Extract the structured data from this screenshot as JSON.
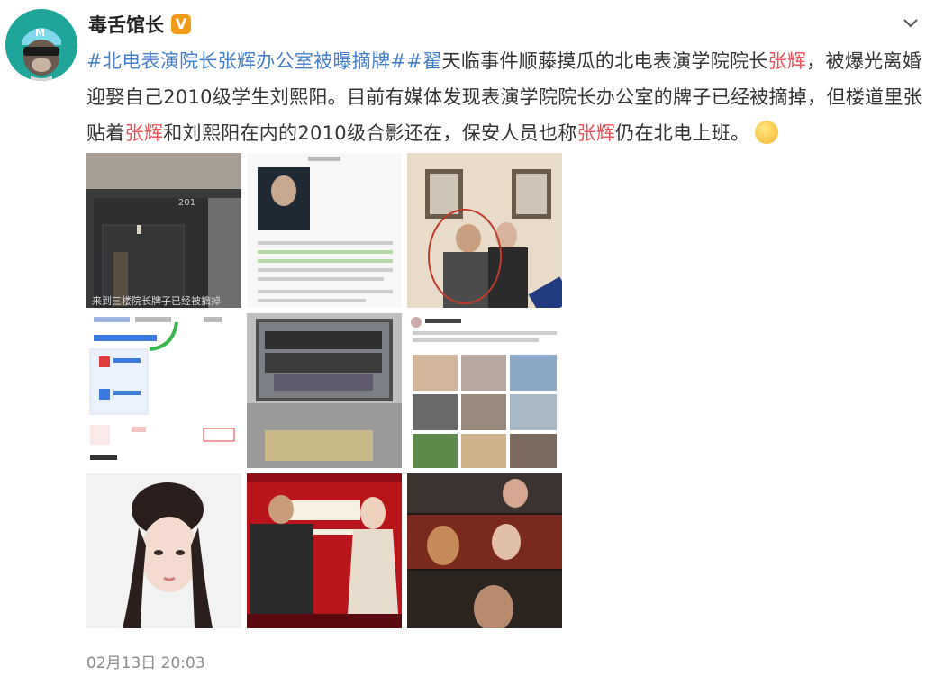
{
  "post": {
    "author": "毒舌馆长",
    "verified_icon": "verified-badge-icon",
    "avatar_icon": "monkey-avatar-icon",
    "more_icon": "chevron-down-icon",
    "text": {
      "hashtag1": "#北电表演院长张辉办公室被曝摘牌#",
      "hashtag2": "#翟",
      "seg1": "天临事件顺藤摸瓜的北电表演学院院长",
      "name1": "张辉",
      "seg2": "，被爆光离婚迎娶自己2010级学生刘熙阳。目前有媒体发现表演学院院长办公室的牌子已经被摘掉，但楼道里张贴着",
      "name2": "张辉",
      "seg3": "和刘熙阳在内的2010级合影还在，保安人员也称",
      "name3": "张辉",
      "seg4": "仍在北电上班。"
    },
    "emoji_icon": "drooling-face-emoji-icon",
    "timestamp": "02月13日 20:03"
  },
  "images": {
    "img1_caption": "来到三楼院长牌子已经被摘掉",
    "img1_door_number": "201"
  },
  "colors": {
    "text": "#333333",
    "hashtag": "#4580c8",
    "highlight": "#e8545a",
    "meta": "#8a8a8a"
  }
}
